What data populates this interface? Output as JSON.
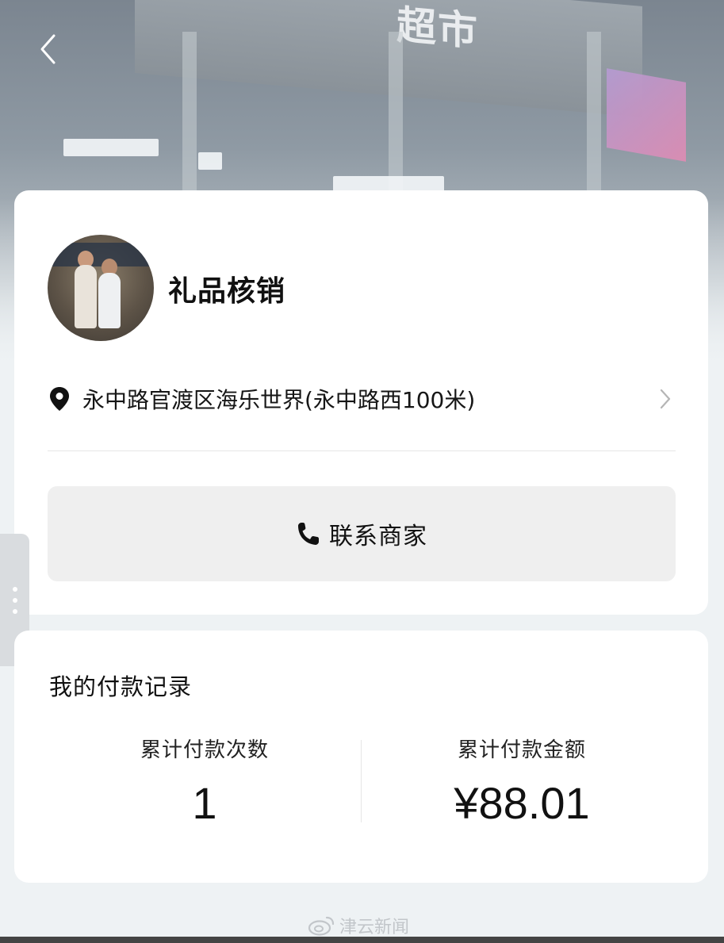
{
  "hero": {
    "sign_text": "超市"
  },
  "merchant": {
    "name": "礼品核销",
    "address": "永中路官渡区海乐世界(永中路西100米)",
    "contact_label": "联系商家"
  },
  "payment_record": {
    "title": "我的付款记录",
    "count_label": "累计付款次数",
    "count_value": "1",
    "amount_label": "累计付款金额",
    "amount_value": "¥88.01"
  },
  "watermark": {
    "text": "津云新闻"
  },
  "icons": {
    "back": "chevron-left-icon",
    "location": "map-pin-icon",
    "arrow": "chevron-right-icon",
    "phone": "phone-icon",
    "more": "more-vertical-icon",
    "weibo": "weibo-logo-icon"
  },
  "colors": {
    "card_background": "#ffffff",
    "page_background": "#eef2f4",
    "button_background": "#efefef",
    "text_primary": "#111111"
  }
}
